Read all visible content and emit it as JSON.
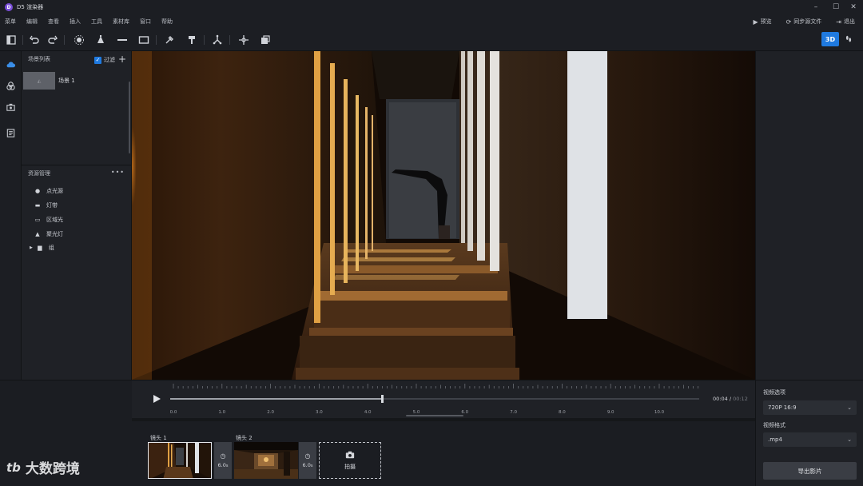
{
  "app": {
    "title": "D5 渲染器",
    "logo_letter": "D"
  },
  "menu": [
    "菜单",
    "编辑",
    "查看",
    "插入",
    "工具",
    "素材库",
    "窗口",
    "帮助"
  ],
  "menubar_right": {
    "preview": "预览",
    "sync": "同步源文件",
    "exit": "退出"
  },
  "toolbar": {
    "mode_3d": "3D"
  },
  "scene_panel": {
    "title": "场景列表",
    "filter_label": "过滤",
    "scenes": [
      {
        "name": "场景 1"
      }
    ]
  },
  "asset_panel": {
    "title": "资源管理",
    "items": [
      {
        "icon": "point-light-icon",
        "label": "点光源"
      },
      {
        "icon": "strip-light-icon",
        "label": "灯带"
      },
      {
        "icon": "area-light-icon",
        "label": "区域光"
      },
      {
        "icon": "spot-light-icon",
        "label": "聚光灯"
      },
      {
        "icon": "folder-icon",
        "label": "组"
      }
    ]
  },
  "timeline": {
    "current": "00:04",
    "separator": "/",
    "total": "00:12",
    "progress": 0.4,
    "ticks": [
      "0.0",
      "1.0",
      "2.0",
      "3.0",
      "4.0",
      "5.0",
      "6.0",
      "7.0",
      "8.0",
      "9.0",
      "10.0"
    ]
  },
  "shots": [
    {
      "label": "镜头 1",
      "duration": "6.0",
      "unit": "s"
    },
    {
      "label": "镜头 2",
      "duration": "6.0",
      "unit": "s"
    }
  ],
  "capture_label": "拍摄",
  "export": {
    "video_options_label": "视频选项",
    "video_options_value": "720P 16:9",
    "format_label": "视频格式",
    "format_value": ".mp4",
    "export_button": "导出影片"
  },
  "watermark": {
    "mark": "tb",
    "text": "大数跨境"
  },
  "colors": {
    "accent": "#1f7ae0",
    "panel": "#1f2126",
    "background": "#1b1d22"
  }
}
